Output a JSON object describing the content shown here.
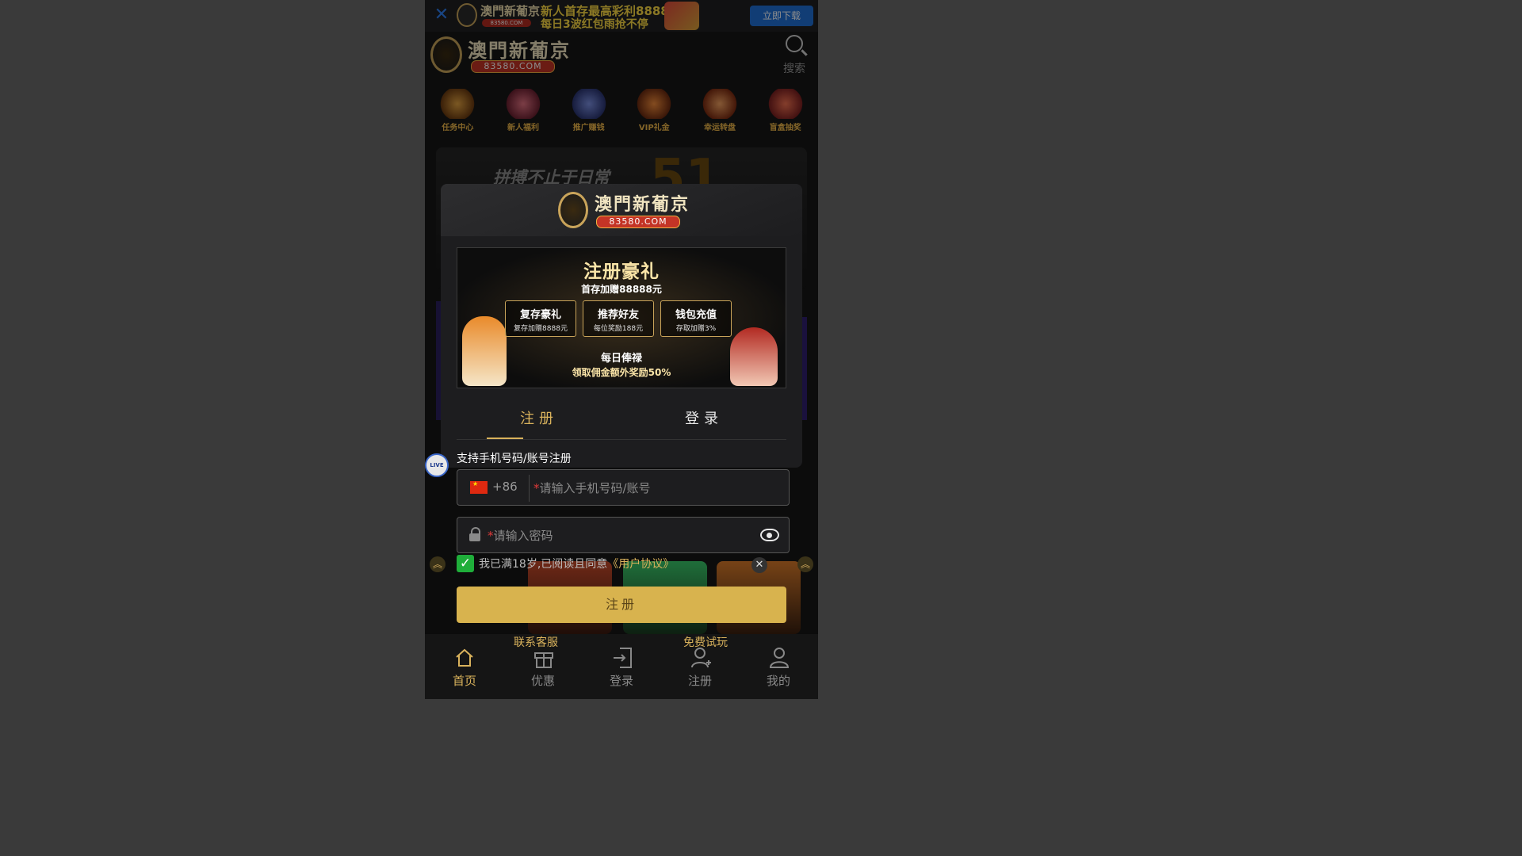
{
  "banner": {
    "close_icon": "close-icon",
    "brand": "澳門新葡京",
    "domain": "83580.COM",
    "promo_line1": "新人首存最高彩利8888",
    "promo_line2": "每日3波红包雨抢不停",
    "download_label": "立即下载"
  },
  "header": {
    "brand": "澳門新葡京",
    "domain": "83580.COM",
    "search_label": "搜索"
  },
  "quick_icons": [
    {
      "label": "任务中心",
      "color": "#c0842a"
    },
    {
      "label": "新人福利",
      "color": "#b8444a"
    },
    {
      "label": "推广赚钱",
      "color": "#5a6ec0"
    },
    {
      "label": "VIP礼金",
      "color": "#d06a2a"
    },
    {
      "label": "幸运转盘",
      "color": "#c8542a"
    },
    {
      "label": "盲盒抽奖",
      "color": "#d24a3a"
    }
  ],
  "hero": {
    "text": "拼搏不止于日常",
    "number": "51"
  },
  "modal": {
    "brand": "澳門新葡京",
    "domain": "83580.COM",
    "promo": {
      "title": "注册豪礼",
      "subtitle": "首存加赠88888元",
      "boxes": [
        {
          "title": "复存豪礼",
          "sub": "复存加赠8888元"
        },
        {
          "title": "推荐好友",
          "sub": "每位奖励188元"
        },
        {
          "title": "钱包充值",
          "sub": "存取加赠3%"
        }
      ],
      "daily_title": "每日俸禄",
      "daily_sub": "领取佣金额外奖励50%"
    },
    "tabs": [
      {
        "label": "注册",
        "active": true
      },
      {
        "label": "登录",
        "active": false
      }
    ],
    "support_text": "支持手机号码/账号注册",
    "phone_field": {
      "country_code": "+86",
      "required_mark": "*",
      "placeholder": "请输入手机号码/账号"
    },
    "password_field": {
      "required_mark": "*",
      "placeholder": "请输入密码"
    },
    "agreement": {
      "checked": true,
      "text": "我已满18岁,已阅读且同意",
      "link": "《用户协议》"
    },
    "submit_label": "注册"
  },
  "floating": {
    "live_label": "LIVE",
    "customer_service": "联系客服",
    "free_trial": "免费试玩"
  },
  "bottom_nav": [
    {
      "label": "首页",
      "icon": "home-icon",
      "active": true
    },
    {
      "label": "优惠",
      "icon": "gift-icon",
      "active": false
    },
    {
      "label": "登录",
      "icon": "login-icon",
      "active": false
    },
    {
      "label": "注册",
      "icon": "add-user-icon",
      "active": false
    },
    {
      "label": "我的",
      "icon": "user-icon",
      "active": false
    }
  ],
  "colors": {
    "accent_gold": "#d9b25c",
    "download_blue": "#1f6fd6",
    "check_green": "#1fae3a"
  }
}
